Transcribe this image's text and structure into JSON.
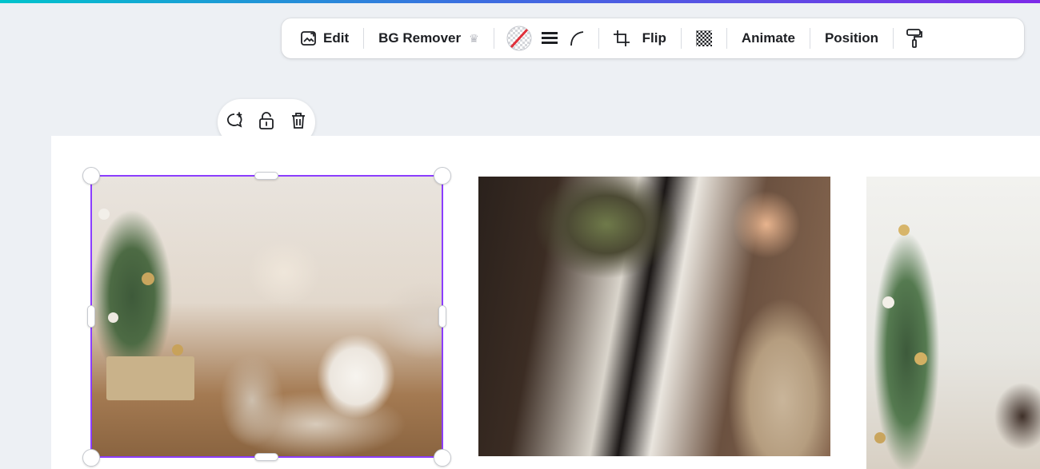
{
  "toolbar": {
    "edit_label": "Edit",
    "bg_remover_label": "BG Remover",
    "flip_label": "Flip",
    "animate_label": "Animate",
    "position_label": "Position"
  },
  "icons": {
    "edit": "image-edit-icon",
    "premium": "crown-icon",
    "border_color": "no-color-swatch-icon",
    "border_style": "border-style-icon",
    "corner_rounding": "corner-rounding-icon",
    "crop": "crop-icon",
    "transparency": "transparency-checker-icon",
    "copy_style": "paint-roller-icon",
    "comment": "add-comment-icon",
    "lock": "lock-icon",
    "delete": "trash-icon"
  },
  "colors": {
    "selection": "#8b3dff",
    "accent_gradient": [
      "#00c4cc",
      "#7d2ae8"
    ],
    "no_color_slash": "#e0303a"
  }
}
